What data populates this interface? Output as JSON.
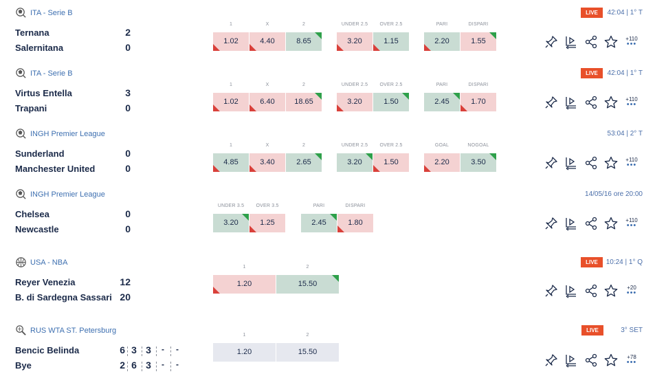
{
  "events": [
    {
      "sport": "soccer",
      "league": "ITA - Serie B",
      "status": {
        "live": "LIVE",
        "time": "42:04 | 1° T"
      },
      "teams": [
        {
          "name": "Ternana",
          "score": "2"
        },
        {
          "name": "Salernitana",
          "score": "0"
        }
      ],
      "odds_groups": [
        {
          "headers": [
            "1",
            "X",
            "2"
          ],
          "values": [
            "1.02",
            "4.40",
            "8.65"
          ],
          "colors": [
            "r",
            "r",
            "g"
          ],
          "arrows": [
            "dn",
            "dn",
            "up"
          ]
        },
        {
          "headers": [
            "UNDER 2.5",
            "OVER 2.5"
          ],
          "values": [
            "3.20",
            "1.15"
          ],
          "colors": [
            "r",
            "g"
          ],
          "arrows": [
            "dn",
            "dn"
          ]
        },
        {
          "headers": [
            "PARI",
            "DISPARI"
          ],
          "values": [
            "2.20",
            "1.55"
          ],
          "colors": [
            "g",
            "r"
          ],
          "arrows": [
            "dn",
            "up"
          ]
        }
      ],
      "more": "+110"
    },
    {
      "sport": "soccer",
      "league": "ITA - Serie B",
      "status": {
        "live": "LIVE",
        "time": "42:04 | 1° T"
      },
      "teams": [
        {
          "name": "Virtus Entella",
          "score": "3"
        },
        {
          "name": "Trapani",
          "score": "0"
        }
      ],
      "odds_groups": [
        {
          "headers": [
            "1",
            "X",
            "2"
          ],
          "values": [
            "1.02",
            "6.40",
            "18.65"
          ],
          "colors": [
            "r",
            "r",
            "r"
          ],
          "arrows": [
            "dn",
            "dn",
            "up"
          ]
        },
        {
          "headers": [
            "UNDER 2.5",
            "OVER 2.5"
          ],
          "values": [
            "3.20",
            "1.50"
          ],
          "colors": [
            "r",
            "g"
          ],
          "arrows": [
            "dn",
            "up"
          ]
        },
        {
          "headers": [
            "PARI",
            "DISPARI"
          ],
          "values": [
            "2.45",
            "1.70"
          ],
          "colors": [
            "g",
            "r"
          ],
          "arrows": [
            "up",
            "dn"
          ]
        }
      ],
      "more": "+110"
    },
    {
      "sport": "soccer",
      "league": "INGH Premier League",
      "status": {
        "live": "",
        "time": "53:04 | 2° T"
      },
      "teams": [
        {
          "name": "Sunderland",
          "score": "0"
        },
        {
          "name": "Manchester United",
          "score": "0"
        }
      ],
      "odds_groups": [
        {
          "headers": [
            "1",
            "X",
            "2"
          ],
          "values": [
            "4.85",
            "3.40",
            "2.65"
          ],
          "colors": [
            "g",
            "r",
            "g"
          ],
          "arrows": [
            "dn",
            "dn",
            "up"
          ]
        },
        {
          "headers": [
            "UNDER 2.5",
            "OVER 2.5"
          ],
          "values": [
            "3.20",
            "1.50"
          ],
          "colors": [
            "g",
            "r"
          ],
          "arrows": [
            "up",
            "dn"
          ]
        },
        {
          "headers": [
            "GOAL",
            "NOGOAL"
          ],
          "values": [
            "2.20",
            "3.50"
          ],
          "colors": [
            "r",
            "g"
          ],
          "arrows": [
            "dn",
            "up"
          ]
        }
      ],
      "more": "+110"
    },
    {
      "sport": "soccer",
      "league": "INGH Premier League",
      "status": {
        "live": "",
        "time": "14/05/16 ore 20:00"
      },
      "teams": [
        {
          "name": "Chelsea",
          "score": "0"
        },
        {
          "name": "Newcastle",
          "score": "0"
        }
      ],
      "odds_groups": [
        {
          "headers": [
            "UNDER 3.5",
            "OVER 3.5"
          ],
          "values": [
            "3.20",
            "1.25"
          ],
          "colors": [
            "g",
            "r"
          ],
          "arrows": [
            "up",
            "dn"
          ]
        },
        {
          "headers": [
            "PARI",
            "DISPARI"
          ],
          "values": [
            "2.45",
            "1.80"
          ],
          "colors": [
            "g",
            "r"
          ],
          "arrows": [
            "up",
            "dn"
          ]
        }
      ],
      "more": "+110"
    },
    {
      "sport": "basketball",
      "league": "USA - NBA",
      "status": {
        "live": "LIVE",
        "time": "10:24 | 1° Q"
      },
      "teams": [
        {
          "name": "Reyer Venezia",
          "score": "12"
        },
        {
          "name": "B. di Sardegna Sassari",
          "score": "20"
        }
      ],
      "odds_groups": [
        {
          "headers": [
            "1",
            "2"
          ],
          "values": [
            "1.20",
            "15.50"
          ],
          "colors": [
            "r",
            "g"
          ],
          "arrows": [
            "dn",
            "up"
          ]
        }
      ],
      "more": "+20"
    },
    {
      "sport": "tennis",
      "league": "RUS WTA ST. Petersburg",
      "status": {
        "live": "LIVE",
        "time": "3° SET"
      },
      "teams": [
        {
          "name": "Bencic Belinda",
          "score": "6",
          "sets": [
            "3",
            "3",
            "-",
            "-"
          ]
        },
        {
          "name": "Bye",
          "score": "2",
          "sets": [
            "6",
            "3",
            "-",
            "-"
          ]
        }
      ],
      "odds_groups": [
        {
          "headers": [
            "1",
            "2"
          ],
          "values": [
            "1.20",
            "15.50"
          ],
          "colors": [
            "n",
            "n"
          ],
          "arrows": [
            "",
            ""
          ]
        }
      ],
      "more": "+78"
    }
  ],
  "icons": {
    "soccer": "soccer-ball-icon",
    "basketball": "basketball-icon",
    "tennis": "tennis-racket-icon",
    "actions": [
      "pin-icon",
      "live-stream-icon",
      "share-icon",
      "favorite-star-icon",
      "more-markets-icon"
    ]
  },
  "colors": {
    "live_badge": "#e8502a",
    "odd_red": "#f4d2d2",
    "odd_green": "#c9dcd3",
    "link": "#3d6fb0"
  }
}
